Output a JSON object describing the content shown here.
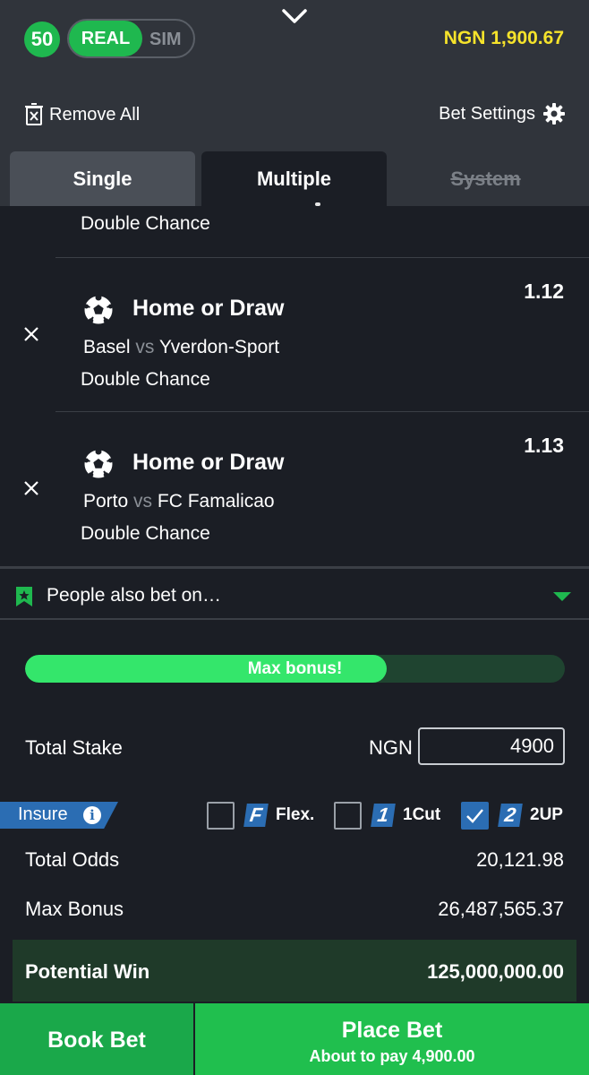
{
  "header": {
    "count_badge": "50",
    "mode_real": "REAL",
    "mode_sim": "SIM",
    "balance": "NGN 1,900.67"
  },
  "toolbar": {
    "remove_all": "Remove All",
    "bet_settings": "Bet Settings"
  },
  "tabs": [
    {
      "label": "Single"
    },
    {
      "label": "Multiple"
    },
    {
      "label": "System"
    }
  ],
  "active_tab": "Multiple",
  "partial_selection_market": "Double Chance",
  "selections": [
    {
      "pick": "Home or Draw",
      "home": "Basel",
      "vs": "vs",
      "away": "Yverdon-Sport",
      "market": "Double Chance",
      "odds": "1.12"
    },
    {
      "pick": "Home or Draw",
      "home": "Porto",
      "vs": "vs",
      "away": "FC Famalicao",
      "market": "Double Chance",
      "odds": "1.13"
    }
  ],
  "people_also_bet": "People also bet on…",
  "bonus_progress": {
    "label": "Max bonus!",
    "fraction": 0.67
  },
  "stake": {
    "label": "Total Stake",
    "currency": "NGN",
    "value": "4900"
  },
  "insure": {
    "label": "Insure",
    "options": [
      {
        "icon_letter": "F",
        "label": "Flex.",
        "checked": false
      },
      {
        "icon_letter": "1",
        "label": "1Cut",
        "checked": false
      },
      {
        "icon_letter": "2",
        "label": "2UP",
        "checked": true
      }
    ]
  },
  "summary": {
    "total_odds_label": "Total Odds",
    "total_odds": "20,121.98",
    "max_bonus_label": "Max Bonus",
    "max_bonus": "26,487,565.37",
    "potential_win_label": "Potential Win",
    "potential_win": "125,000,000.00"
  },
  "actions": {
    "book_bet": "Book Bet",
    "place_bet": "Place Bet",
    "pay_note": "About to pay 4,900.00"
  },
  "colors": {
    "accent_green": "#1fb84f",
    "balance_yellow": "#f6e32b",
    "insure_blue": "#2b6db3"
  }
}
